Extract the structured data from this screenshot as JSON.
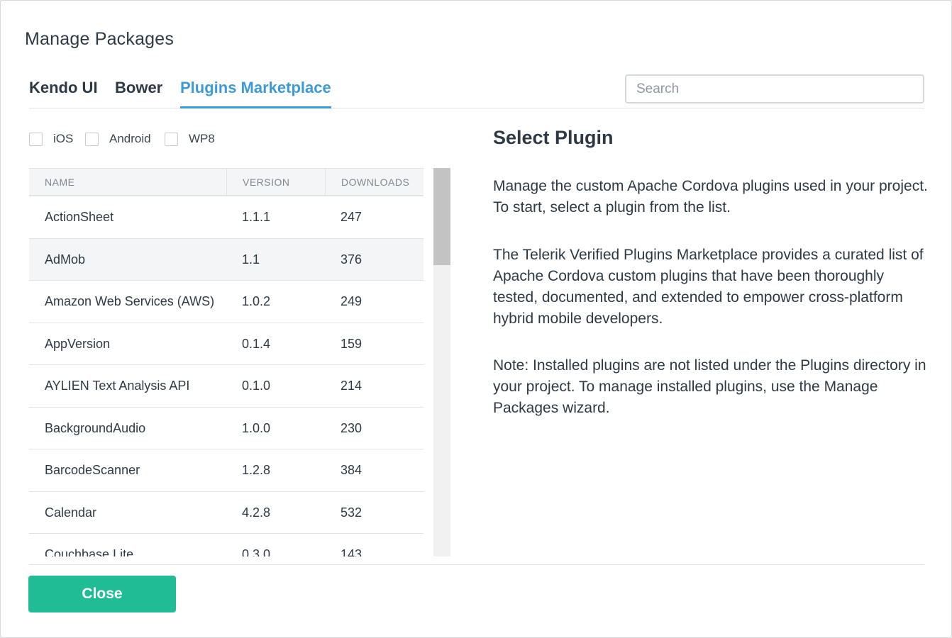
{
  "dialog": {
    "title": "Manage Packages"
  },
  "tabs": [
    {
      "label": "Kendo UI",
      "active": false
    },
    {
      "label": "Bower",
      "active": false
    },
    {
      "label": "Plugins Marketplace",
      "active": true
    }
  ],
  "search": {
    "placeholder": "Search",
    "value": ""
  },
  "filters": [
    {
      "label": "iOS",
      "checked": false
    },
    {
      "label": "Android",
      "checked": false
    },
    {
      "label": "WP8",
      "checked": false
    }
  ],
  "table": {
    "columns": [
      "NAME",
      "VERSION",
      "DOWNLOADS"
    ],
    "rows": [
      {
        "name": "ActionSheet",
        "version": "1.1.1",
        "downloads": "247"
      },
      {
        "name": "AdMob",
        "version": "1.1",
        "downloads": "376"
      },
      {
        "name": "Amazon Web Services (AWS)",
        "version": "1.0.2",
        "downloads": "249"
      },
      {
        "name": "AppVersion",
        "version": "0.1.4",
        "downloads": "159"
      },
      {
        "name": "AYLIEN Text Analysis API",
        "version": "0.1.0",
        "downloads": "214"
      },
      {
        "name": "BackgroundAudio",
        "version": "1.0.0",
        "downloads": "230"
      },
      {
        "name": "BarcodeScanner",
        "version": "1.2.8",
        "downloads": "384"
      },
      {
        "name": "Calendar",
        "version": "4.2.8",
        "downloads": "532"
      },
      {
        "name": "Couchbase Lite",
        "version": "0.3.0",
        "downloads": "143"
      }
    ]
  },
  "info": {
    "title": "Select Plugin",
    "paragraphs": [
      "Manage the custom Apache Cordova plugins used in your project. To start, select a plugin from the list.",
      "The Telerik Verified Plugins Marketplace provides a curated list of Apache Cordova custom plugins that have been thoroughly tested, documented, and extended to empower cross-platform hybrid mobile developers.",
      "Note: Installed plugins are not listed under the Plugins directory in your project. To manage installed plugins, use the Manage Packages wizard."
    ]
  },
  "footer": {
    "close_label": "Close"
  },
  "colors": {
    "accent": "#3d9ad8",
    "primary_button": "#1fbc95",
    "text": "#2d3a45"
  }
}
